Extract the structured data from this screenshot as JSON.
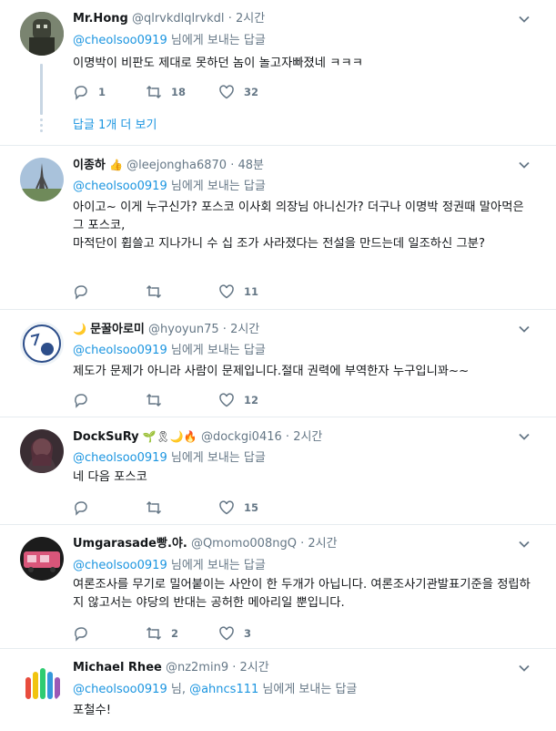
{
  "tweets": [
    {
      "name": "Mr.Hong",
      "handle": "@qlrvkdlqlrvkdl",
      "time": "2시간",
      "reply_to": "@cheolsoo0919",
      "reply_suffix": "님에게 보내는 답글",
      "text": "이명박이 비판도 제대로 못하던 놈이 놀고자빠졌네 ㅋㅋㅋ",
      "replies": "1",
      "retweets": "18",
      "likes": "32",
      "more_replies": "답글 1개 더 보기"
    },
    {
      "name": "이종하",
      "badge": "👍",
      "handle": "@leejongha6870",
      "time": "48분",
      "reply_to": "@cheolsoo0919",
      "reply_suffix": "님에게 보내는 답글",
      "text": "아이고~ 이게 누구신가? 포스코 이사회 의장님 아니신가? 더구나 이명박 정권때 말아먹은 그 포스코,",
      "text2": "마적단이 휩쓸고 지나가니 수 십 조가 사라졌다는 전설을 만드는데 일조하신 그분?",
      "replies": "",
      "retweets": "",
      "likes": "11"
    },
    {
      "name": "문꿀아로미",
      "badge": "🌙",
      "handle": "@hyoyun75",
      "time": "2시간",
      "reply_to": "@cheolsoo0919",
      "reply_suffix": "님에게 보내는 답글",
      "text": "제도가 문제가 아니라 사람이 문제입니다.절대 권력에 부역한자 누구입니꽈~~",
      "replies": "",
      "retweets": "",
      "likes": "12"
    },
    {
      "name": "DockSuRy",
      "badge": "🌱🎗🌙🔥",
      "handle": "@dockgi0416",
      "time": "2시간",
      "reply_to": "@cheolsoo0919",
      "reply_suffix": "님에게 보내는 답글",
      "text": "네 다음 포스코",
      "replies": "",
      "retweets": "",
      "likes": "15"
    },
    {
      "name": "Umgarasade빵.야.",
      "handle": "@Qmomo008ngQ",
      "time": "2시간",
      "reply_to": "@cheolsoo0919",
      "reply_suffix": "님에게 보내는 답글",
      "text": "여론조사를 무기로 밀어붙이는 사안이 한 두개가 아닙니다. 여론조사기관발표기준을 정립하지 않고서는 야당의 반대는 공허한 메아리일 뿐입니다.",
      "replies": "",
      "retweets": "2",
      "likes": "3"
    },
    {
      "name": "Michael Rhee",
      "handle": "@nz2min9",
      "time": "2시간",
      "reply_to": "@cheolsoo0919",
      "reply_mid": "님,",
      "reply_to2": "@ahncs111",
      "reply_suffix": "님에게 보내는 답글",
      "text": "포철수!"
    }
  ],
  "separator": "·",
  "colors": {
    "link": "#1b95e0",
    "secondary": "#657786",
    "border": "#e6ecf0",
    "thread": "#c8d6e3"
  },
  "icons": [
    "reply-icon",
    "retweet-icon",
    "like-icon",
    "chevron-down-icon"
  ]
}
